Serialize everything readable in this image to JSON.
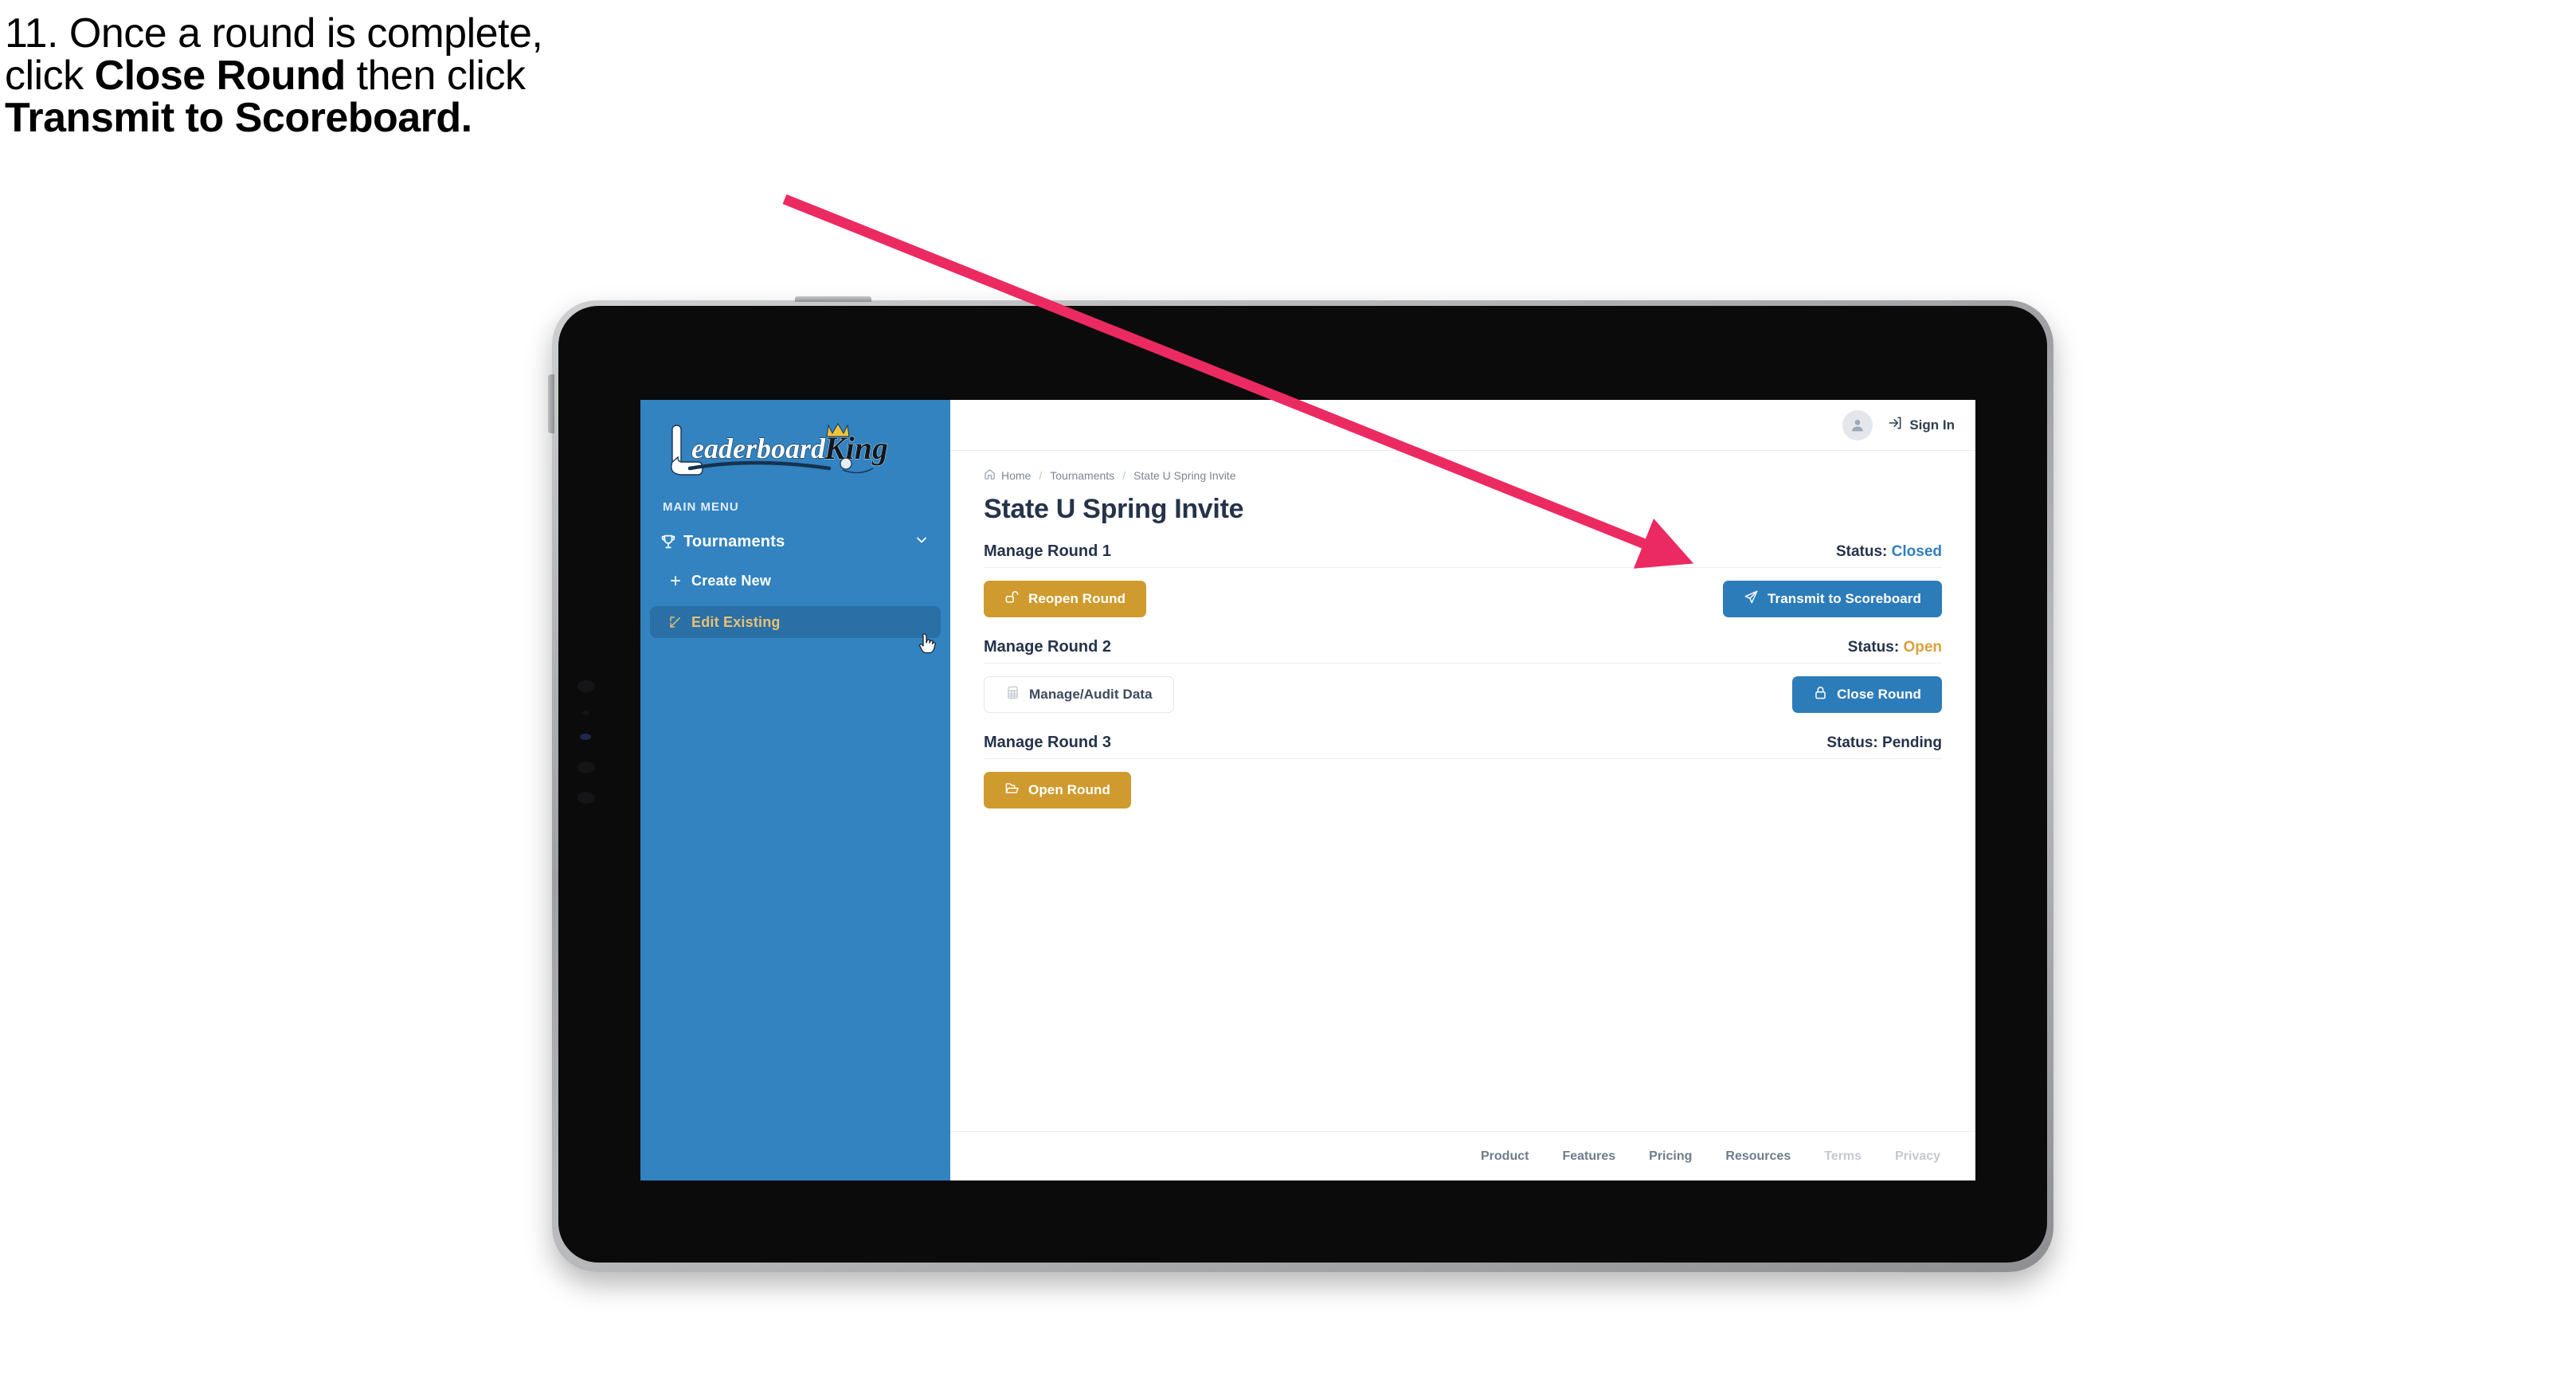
{
  "caption": {
    "line1": "11. Once a round is complete,",
    "line2_a": "click ",
    "line2_b": "Close Round",
    "line2_c": " then click",
    "line3": "Transmit to Scoreboard."
  },
  "colors": {
    "sidebar_blue": "#3283c0",
    "sidebar_active": "#2a6fa6",
    "sidebar_active_text": "#e7c174",
    "gold_button": "#cf9b2e",
    "blue_button": "#2d7cba",
    "status_closed": "#2f7fc0",
    "status_open": "#d9a23a",
    "arrow_pink": "#ec2a62",
    "title_navy": "#25334a"
  },
  "sidebar": {
    "logo_primary": "Leaderboard",
    "logo_secondary": "King",
    "section_label": "MAIN MENU",
    "nav": {
      "label": "Tournaments",
      "icon": "trophy-icon",
      "chevron": "chevron-down-icon"
    },
    "items": [
      {
        "label": "Create New",
        "icon": "plus-icon",
        "active": false
      },
      {
        "label": "Edit Existing",
        "icon": "edit-pencil-icon",
        "active": true
      }
    ]
  },
  "topbar": {
    "avatar_icon": "user-avatar-icon",
    "signin_icon": "sign-in-arrow-icon",
    "signin_label": "Sign In"
  },
  "breadcrumb": {
    "home_icon": "home-icon",
    "items": [
      "Home",
      "Tournaments",
      "State U Spring Invite"
    ],
    "separator": "/"
  },
  "page": {
    "title": "State U Spring Invite"
  },
  "rounds": [
    {
      "name": "Manage Round 1",
      "status_label": "Status:",
      "status_value": "Closed",
      "status_style": "closed",
      "left_button": {
        "label": "Reopen Round",
        "icon": "unlock-icon",
        "style": "gold"
      },
      "right_button": {
        "label": "Transmit to Scoreboard",
        "icon": "paper-plane-icon",
        "style": "blue"
      }
    },
    {
      "name": "Manage Round 2",
      "status_label": "Status:",
      "status_value": "Open",
      "status_style": "open",
      "left_button": {
        "label": "Manage/Audit Data",
        "icon": "table-grid-icon",
        "style": "white"
      },
      "right_button": {
        "label": "Close Round",
        "icon": "lock-icon",
        "style": "blue"
      }
    },
    {
      "name": "Manage Round 3",
      "status_label": "Status:",
      "status_value": "Pending",
      "status_style": "plain",
      "left_button": {
        "label": "Open Round",
        "icon": "open-folder-icon",
        "style": "gold"
      },
      "right_button": null
    }
  ],
  "footer": {
    "links": [
      {
        "label": "Product",
        "muted": false
      },
      {
        "label": "Features",
        "muted": false
      },
      {
        "label": "Pricing",
        "muted": false
      },
      {
        "label": "Resources",
        "muted": false
      },
      {
        "label": "Terms",
        "muted": true
      },
      {
        "label": "Privacy",
        "muted": true
      }
    ]
  },
  "annotation": {
    "type": "arrow",
    "points_to": "Transmit to Scoreboard button"
  }
}
